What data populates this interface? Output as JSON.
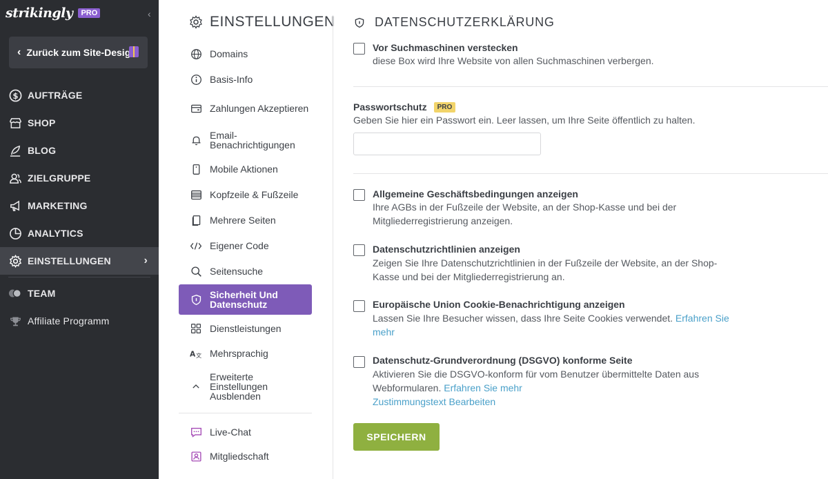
{
  "app": {
    "logo": "strikingly",
    "plan_badge": "PRO"
  },
  "sidebar": {
    "back_label": "Zurück zum Site-Desig",
    "items": [
      {
        "label": "AUFTRÄGE",
        "icon": "dollar-circle-icon"
      },
      {
        "label": "SHOP",
        "icon": "store-icon"
      },
      {
        "label": "BLOG",
        "icon": "feather-icon"
      },
      {
        "label": "ZIELGRUPPE",
        "icon": "users-icon"
      },
      {
        "label": "MARKETING",
        "icon": "megaphone-icon"
      },
      {
        "label": "ANALYTICS",
        "icon": "pie-chart-icon"
      },
      {
        "label": "EINSTELLUNGEN",
        "icon": "gear-icon",
        "active": true
      },
      {
        "label": "TEAM",
        "icon": "team-icon"
      },
      {
        "label": "Affiliate Programm",
        "icon": "trophy-icon"
      }
    ]
  },
  "settings_nav": {
    "title": "EINSTELLUNGEN",
    "items": [
      {
        "label": "Domains",
        "icon": "globe-icon"
      },
      {
        "label": "Basis-Info",
        "icon": "info-icon"
      },
      {
        "label": "Zahlungen Akzeptieren",
        "icon": "wallet-icon"
      },
      {
        "label": "Email-Benachrichtigungen",
        "icon": "bell-icon"
      },
      {
        "label": "Mobile Aktionen",
        "icon": "mobile-icon"
      },
      {
        "label": "Kopfzeile & Fußzeile",
        "icon": "header-footer-icon"
      },
      {
        "label": "Mehrere Seiten",
        "icon": "pages-icon"
      },
      {
        "label": "Eigener Code",
        "icon": "code-icon"
      },
      {
        "label": "Seitensuche",
        "icon": "search-icon"
      },
      {
        "label": "Sicherheit Und Datenschutz",
        "icon": "shield-icon",
        "active": true
      },
      {
        "label": "Dienstleistungen",
        "icon": "grid-icon"
      },
      {
        "label": "Mehrsprachig",
        "icon": "translate-icon"
      },
      {
        "label": "Erweiterte Einstellungen Ausblenden",
        "icon": "chevron-up-icon"
      },
      {
        "label": "Live-Chat",
        "icon": "chat-icon"
      },
      {
        "label": "Mitgliedschaft",
        "icon": "member-icon"
      }
    ]
  },
  "main": {
    "title": "DATENSCHUTZERKLÄRUNG",
    "search_engines": {
      "title": "Vor Suchmaschinen verstecken",
      "desc": "diese Box wird Ihre Website von allen Suchmaschinen verbergen."
    },
    "password": {
      "label": "Passwortschutz",
      "badge": "PRO",
      "desc": "Geben Sie hier ein Passwort ein. Leer lassen, um Ihre Seite öffentlich zu halten.",
      "value": ""
    },
    "options": [
      {
        "title": "Allgemeine Geschäftsbedingungen anzeigen",
        "desc": "Ihre AGBs in der Fußzeile der Website, an der Shop-Kasse und bei der Mitgliederregistrierung anzeigen."
      },
      {
        "title": "Datenschutzrichtlinien anzeigen",
        "desc": "Zeigen Sie Ihre Datenschutzrichtlinien in der Fußzeile der Website, an der Shop-Kasse und bei der Mitgliederregistrierung an."
      },
      {
        "title": "Europäische Union Cookie-Benachrichtigung anzeigen",
        "desc": "Lassen Sie Ihre Besucher wissen, dass Ihre Seite Cookies verwendet.",
        "link": "Erfahren Sie mehr"
      },
      {
        "title": "Datenschutz-Grundverordnung (DSGVO) konforme Seite",
        "desc": "Aktivieren Sie die DSGVO-konform für vom Benutzer übermittelte Daten aus Webformularen.",
        "link": "Erfahren Sie mehr",
        "link2": "Zustimmungstext Bearbeiten"
      }
    ],
    "save_label": "SPEICHERN"
  },
  "colors": {
    "sidebar_bg": "#2b2d31",
    "accent_purple": "#7e5bb8",
    "save_green": "#8fb040",
    "link_blue": "#4aa0c9",
    "pro_yellow": "#f2d46a"
  }
}
